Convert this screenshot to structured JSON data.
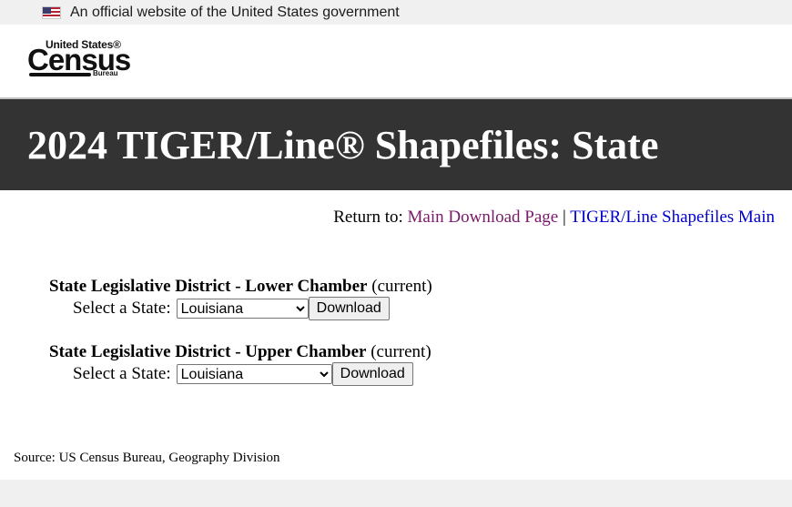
{
  "gov_banner": {
    "text": "An official website of the United States government",
    "icon": "us-flag-icon"
  },
  "logo": {
    "line1": "United States®",
    "line2": "Census",
    "line3": "Bureau"
  },
  "page_title": "2024 TIGER/Line® Shapefiles: State",
  "return_nav": {
    "prefix": "Return to:",
    "link1": "Main Download Page",
    "separator": "|",
    "link2": "TIGER/Line Shapefiles Main"
  },
  "sections": [
    {
      "title": "State Legislative District - Lower Chamber",
      "qualifier": "(current)",
      "select_label": "Select a State:",
      "selected_state": "Louisiana",
      "button_label": "Download"
    },
    {
      "title": "State Legislative District - Upper Chamber",
      "qualifier": "(current)",
      "select_label": "Select a State:",
      "selected_state": "Louisiana",
      "button_label": "Download"
    }
  ],
  "source": "Source: US Census Bureau, Geography Division",
  "colors": {
    "title_bar": "#333333",
    "visited_link": "#7a1a6a",
    "link": "#0000cc"
  }
}
